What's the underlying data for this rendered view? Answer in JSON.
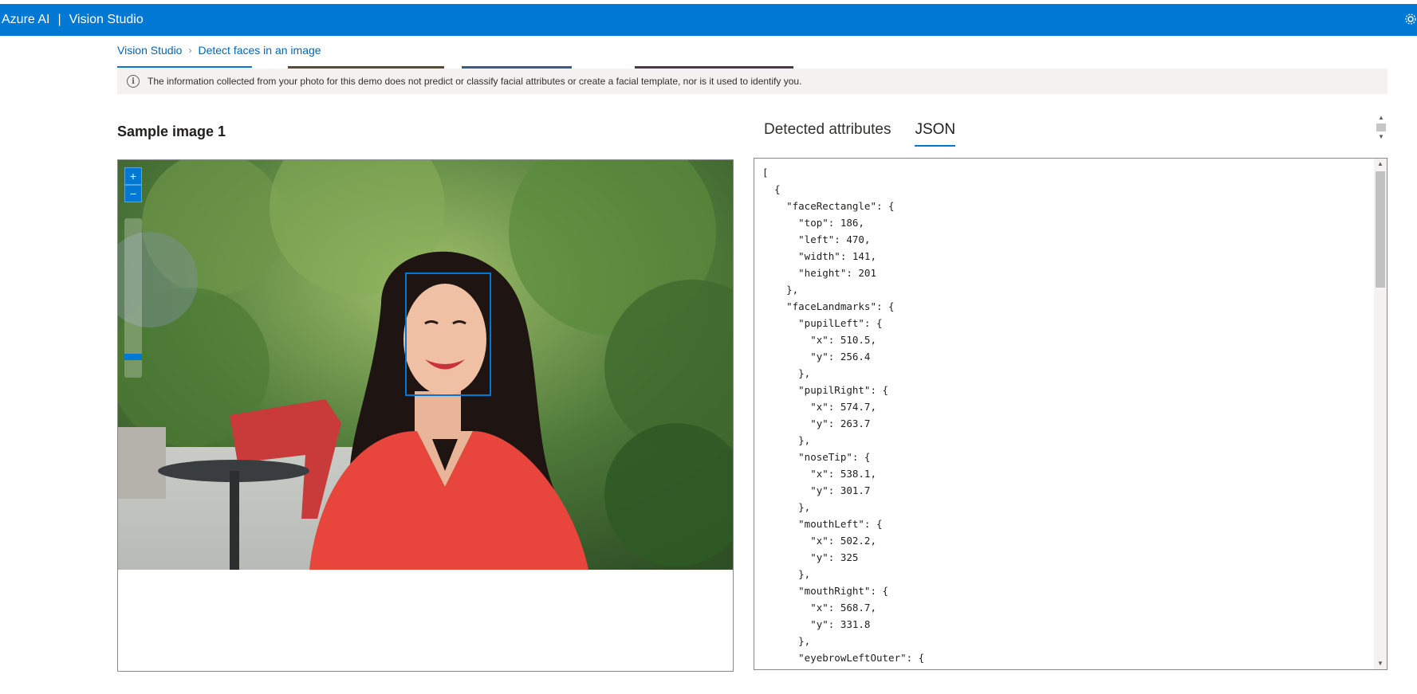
{
  "header": {
    "brand_left": "Azure AI",
    "brand_sep": "|",
    "brand_right": "Vision Studio",
    "settings_icon": "gear-icon"
  },
  "breadcrumb": {
    "items": [
      "Vision Studio",
      "Detect faces in an image"
    ]
  },
  "info_banner": {
    "icon": "info-icon",
    "text": "The information collected from your photo for this demo does not predict or classify facial attributes or create a facial template, nor is it used to identify you."
  },
  "left_panel": {
    "title": "Sample image 1",
    "zoom_in": "+",
    "zoom_out": "−"
  },
  "right_panel": {
    "tabs": [
      {
        "label": "Detected attributes",
        "active": false
      },
      {
        "label": "JSON",
        "active": true
      }
    ],
    "json_lines": [
      "[",
      "  {",
      "    \"faceRectangle\": {",
      "      \"top\": 186,",
      "      \"left\": 470,",
      "      \"width\": 141,",
      "      \"height\": 201",
      "    },",
      "    \"faceLandmarks\": {",
      "      \"pupilLeft\": {",
      "        \"x\": 510.5,",
      "        \"y\": 256.4",
      "      },",
      "      \"pupilRight\": {",
      "        \"x\": 574.7,",
      "        \"y\": 263.7",
      "      },",
      "      \"noseTip\": {",
      "        \"x\": 538.1,",
      "        \"y\": 301.7",
      "      },",
      "      \"mouthLeft\": {",
      "        \"x\": 502.2,",
      "        \"y\": 325",
      "      },",
      "      \"mouthRight\": {",
      "        \"x\": 568.7,",
      "        \"y\": 331.8",
      "      },",
      "      \"eyebrowLeftOuter\": {"
    ]
  },
  "colors": {
    "accent": "#0078d4",
    "banner_bg": "#f3f2f1",
    "shirt": "#e8453c"
  }
}
